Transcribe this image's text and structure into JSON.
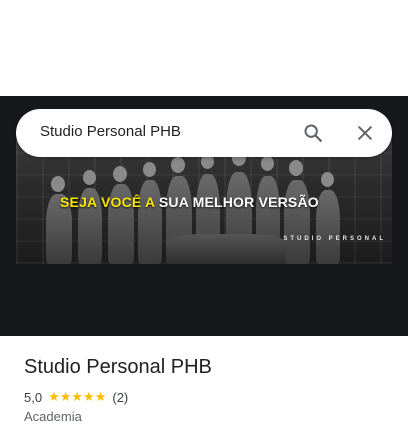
{
  "search": {
    "query": "Studio Personal PHB"
  },
  "banner": {
    "slogan_highlight": "SEJA VOCÊ A",
    "slogan_rest": " SUA MELHOR VERSÃO",
    "brand_tag": "STUDIO PERSONAL"
  },
  "place": {
    "name": "Studio Personal PHB",
    "rating": "5,0",
    "stars": "★★★★★",
    "review_count": "(2)",
    "category": "Academia"
  },
  "colors": {
    "star": "#fbbc04",
    "slogan_highlight": "#f5e400",
    "hero_bg": "#17181b"
  },
  "icons": {
    "search": "search-icon",
    "close": "close-icon"
  }
}
